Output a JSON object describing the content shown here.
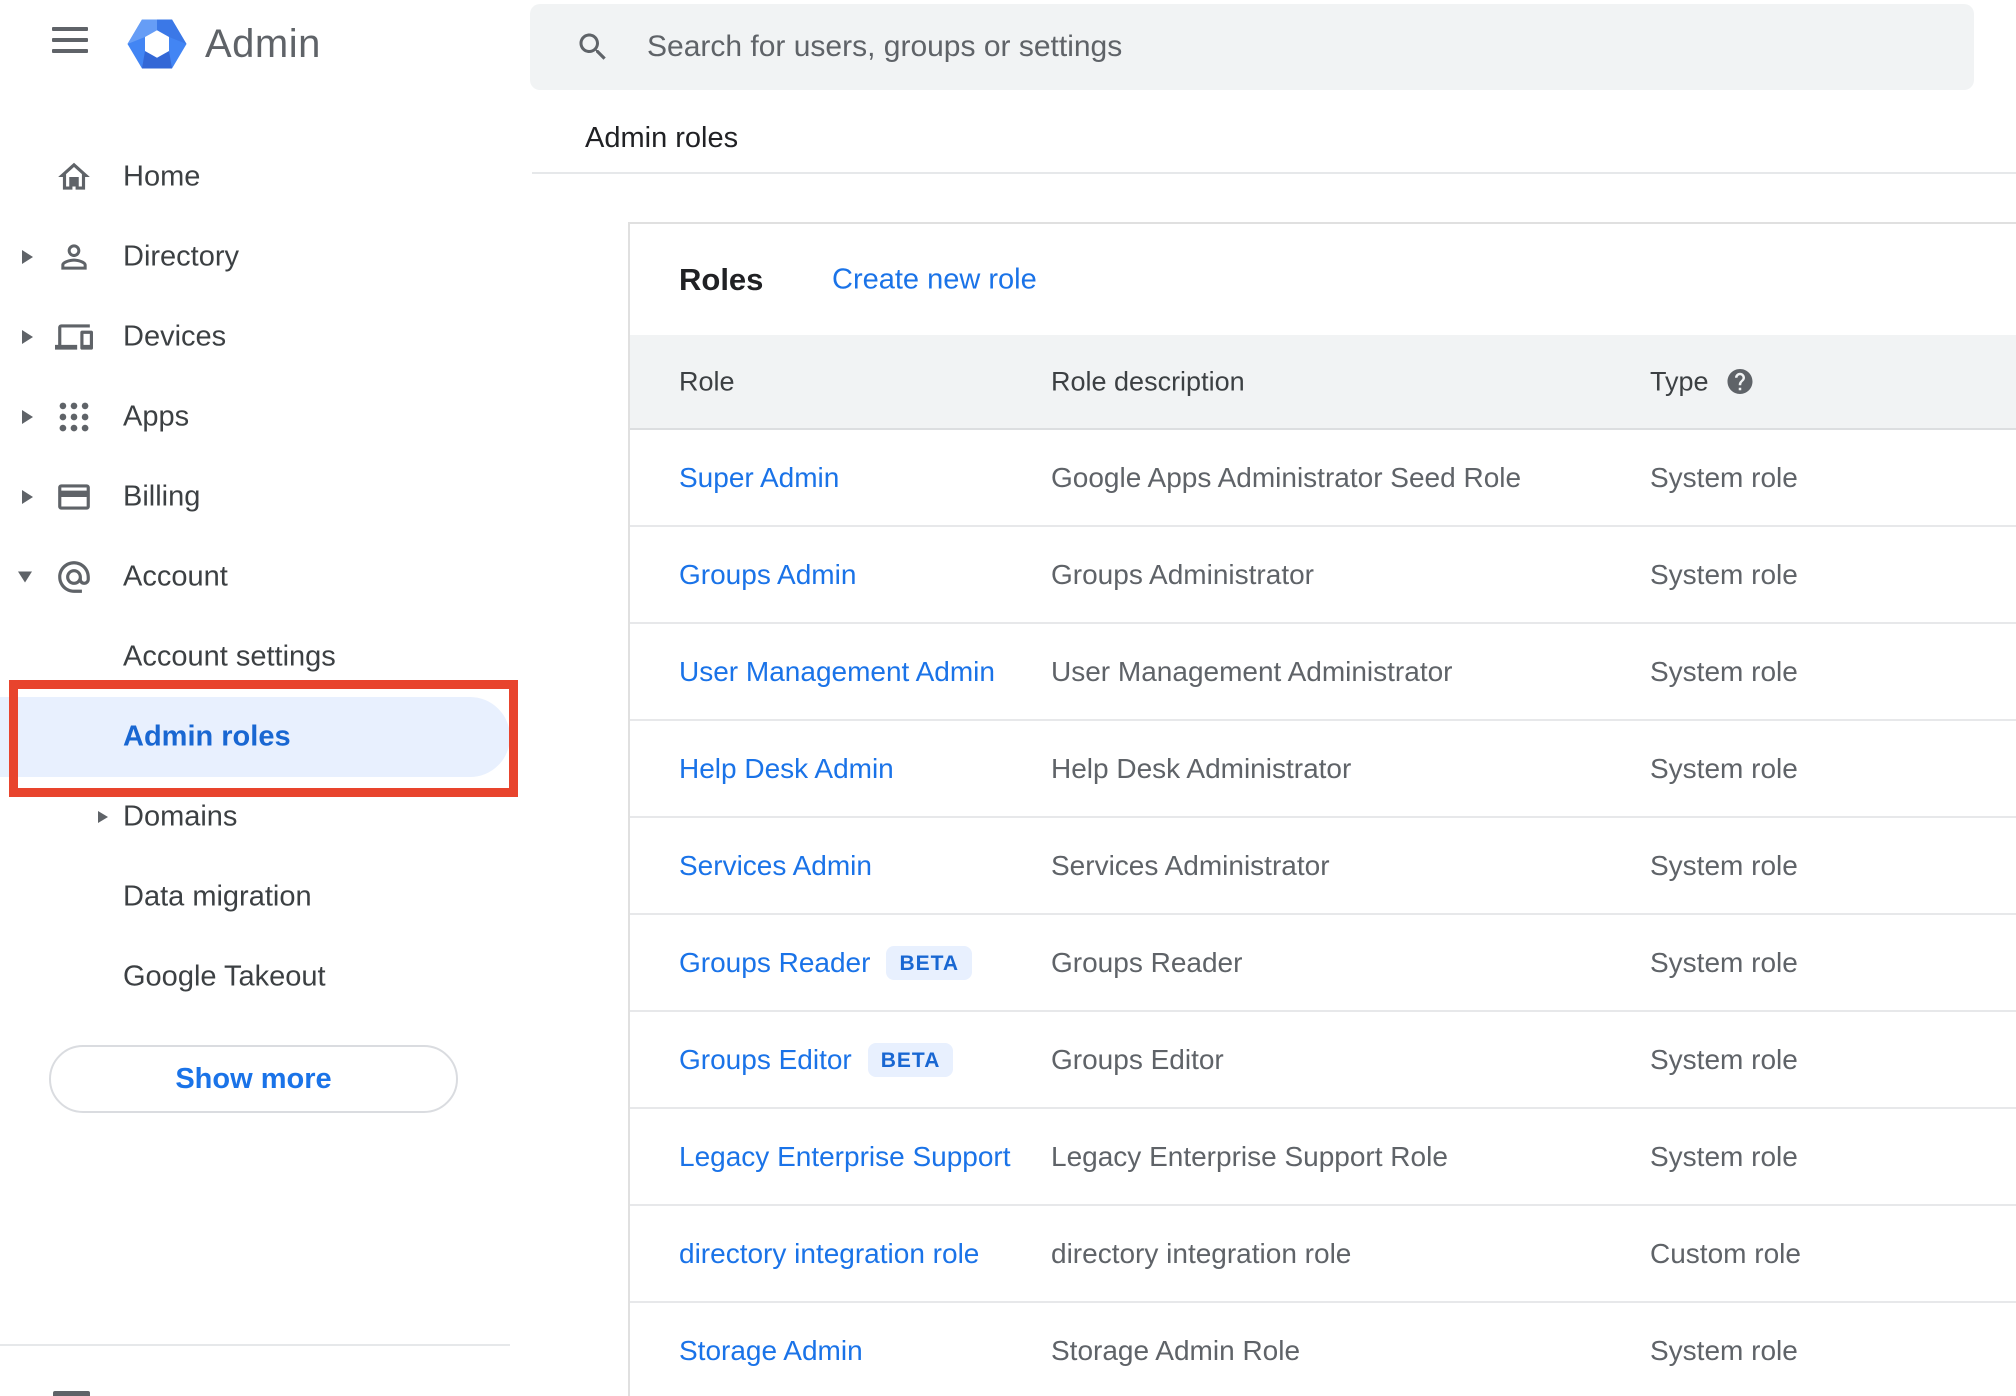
{
  "app": {
    "name": "Admin",
    "logo_icon": "admin-logo-icon"
  },
  "topbar": {
    "search": {
      "icon": "search-icon",
      "placeholder": "Search for users, groups or settings",
      "value": ""
    }
  },
  "breadcrumb": {
    "label": "Admin roles"
  },
  "sidebar": {
    "items": [
      {
        "label": "Home",
        "icon": "home-icon",
        "indent": 0,
        "expander": "none",
        "selected": false
      },
      {
        "label": "Directory",
        "icon": "directory-icon",
        "indent": 0,
        "expander": "collapsed",
        "selected": false
      },
      {
        "label": "Devices",
        "icon": "devices-icon",
        "indent": 0,
        "expander": "collapsed",
        "selected": false
      },
      {
        "label": "Apps",
        "icon": "apps-icon",
        "indent": 0,
        "expander": "collapsed",
        "selected": false
      },
      {
        "label": "Billing",
        "icon": "billing-icon",
        "indent": 0,
        "expander": "collapsed",
        "selected": false
      },
      {
        "label": "Account",
        "icon": "account-icon",
        "indent": 0,
        "expander": "expanded",
        "selected": false
      },
      {
        "label": "Account settings",
        "indent": 1,
        "expander": "none",
        "selected": false
      },
      {
        "label": "Admin roles",
        "indent": 1,
        "expander": "none",
        "selected": true,
        "annotated": true
      },
      {
        "label": "Domains",
        "indent": 1,
        "expander": "collapsed",
        "selected": false
      },
      {
        "label": "Data migration",
        "indent": 1,
        "expander": "none",
        "selected": false
      },
      {
        "label": "Google Takeout",
        "indent": 1,
        "expander": "none",
        "selected": false
      }
    ],
    "show_more": "Show more"
  },
  "main": {
    "title": "Roles",
    "create_link": "Create new role",
    "table": {
      "columns": [
        {
          "label": "Role"
        },
        {
          "label": "Role description"
        },
        {
          "label": "Type",
          "help_icon": "help-icon"
        }
      ],
      "rows": [
        {
          "role": "Super Admin",
          "description": "Google Apps Administrator Seed Role",
          "type": "System role"
        },
        {
          "role": "Groups Admin",
          "description": "Groups Administrator",
          "type": "System role"
        },
        {
          "role": "User Management Admin",
          "description": "User Management Administrator",
          "type": "System role"
        },
        {
          "role": "Help Desk Admin",
          "description": "Help Desk Administrator",
          "type": "System role"
        },
        {
          "role": "Services Admin",
          "description": "Services Administrator",
          "type": "System role"
        },
        {
          "role": "Groups Reader",
          "badge": "BETA",
          "description": "Groups Reader",
          "type": "System role"
        },
        {
          "role": "Groups Editor",
          "badge": "BETA",
          "description": "Groups Editor",
          "type": "System role"
        },
        {
          "role": "Legacy Enterprise Support",
          "description": "Legacy Enterprise Support Role",
          "type": "System role"
        },
        {
          "role": "directory integration role",
          "description": "directory integration role",
          "type": "Custom role"
        },
        {
          "role": "Storage Admin",
          "description": "Storage Admin Role",
          "type": "System role"
        }
      ]
    }
  },
  "annotation": {
    "shape": "rectangle",
    "color": "#e8442d",
    "target": "sidebar-item-admin-roles"
  },
  "colors": {
    "accent_blue": "#1a73e8",
    "selected_text_blue": "#1967d2",
    "selected_bg": "#e8f0fe",
    "beta_badge_bg": "#e8f0fe",
    "beta_badge_text": "#1967d2",
    "table_header_bg": "#f1f3f4",
    "search_bg": "#f1f3f4",
    "annotation_red": "#e8442d",
    "icon_gray": "#5f6368",
    "text_dark": "#202124",
    "text_gray": "#5f6368",
    "logo_blue": "#4285f4"
  }
}
